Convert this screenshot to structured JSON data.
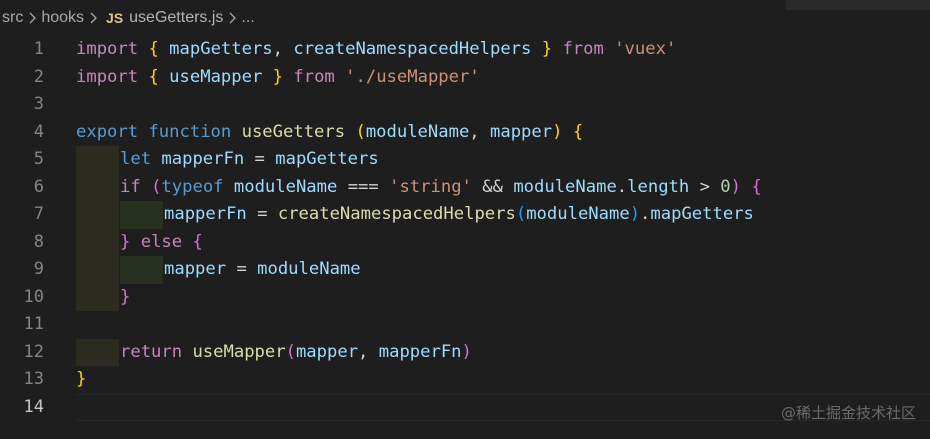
{
  "breadcrumb": {
    "folder1": "src",
    "folder2": "hooks",
    "file_badge": "JS",
    "file": "useGetters.js",
    "ellipsis": "..."
  },
  "gutter": {
    "line_numbers": [
      "1",
      "2",
      "3",
      "4",
      "5",
      "6",
      "7",
      "8",
      "9",
      "10",
      "11",
      "12",
      "13",
      "14"
    ],
    "active_line": "14"
  },
  "code": {
    "l1": {
      "t1": "import",
      "t2": " ",
      "t3": "{",
      "t4": " ",
      "t5": "mapGetters",
      "t6": ", ",
      "t7": "createNamespacedHelpers",
      "t8": " ",
      "t9": "}",
      "t10": " ",
      "t11": "from",
      "t12": " ",
      "t13": "'vuex'"
    },
    "l2": {
      "t1": "import",
      "t2": " ",
      "t3": "{",
      "t4": " ",
      "t5": "useMapper",
      "t6": " ",
      "t7": "}",
      "t8": " ",
      "t9": "from",
      "t10": " ",
      "t11": "'./useMapper'"
    },
    "l4": {
      "t1": "export",
      "t2": " ",
      "t3": "function",
      "t4": " ",
      "t5": "useGetters",
      "t6": " ",
      "t7": "(",
      "t8": "moduleName",
      "t9": ", ",
      "t10": "mapper",
      "t11": ")",
      "t12": " ",
      "t13": "{"
    },
    "l5": {
      "t1": "let",
      "t2": " ",
      "t3": "mapperFn",
      "t4": " = ",
      "t5": "mapGetters"
    },
    "l6": {
      "t1": "if",
      "t2": " ",
      "t3": "(",
      "t4": "typeof",
      "t5": " ",
      "t6": "moduleName",
      "t7": " === ",
      "t8": "'string'",
      "t9": " && ",
      "t10": "moduleName",
      "t11": ".",
      "t12": "length",
      "t13": " > ",
      "t14": "0",
      "t15": ")",
      "t16": " ",
      "t17": "{"
    },
    "l7": {
      "t1": "mapperFn",
      "t2": " = ",
      "t3": "createNamespacedHelpers",
      "t4": "(",
      "t5": "moduleName",
      "t6": ")",
      "t7": ".",
      "t8": "mapGetters"
    },
    "l8": {
      "t1": "}",
      "t2": " ",
      "t3": "else",
      "t4": " ",
      "t5": "{"
    },
    "l9": {
      "t1": "mapper",
      "t2": " = ",
      "t3": "moduleName"
    },
    "l10": {
      "t1": "}"
    },
    "l12": {
      "t1": "return",
      "t2": " ",
      "t3": "useMapper",
      "t4": "(",
      "t5": "mapper",
      "t6": ", ",
      "t7": "mapperFn",
      "t8": ")"
    },
    "l13": {
      "t1": "}"
    }
  },
  "watermark": "@稀土掘金技术社区",
  "colors": {
    "background": "#1e1e1e",
    "keyword_control": "#c586c0",
    "keyword_storage": "#569cd6",
    "function": "#dcdcaa",
    "variable": "#9cdcfe",
    "string": "#ce9178",
    "number": "#b5cea8",
    "bracket_level1": "#ffd700",
    "bracket_level2": "#da70d6",
    "bracket_level3": "#179fff"
  },
  "icons": {
    "breadcrumb_separator": "chevron-right-icon",
    "file_type": "javascript-file-icon"
  }
}
